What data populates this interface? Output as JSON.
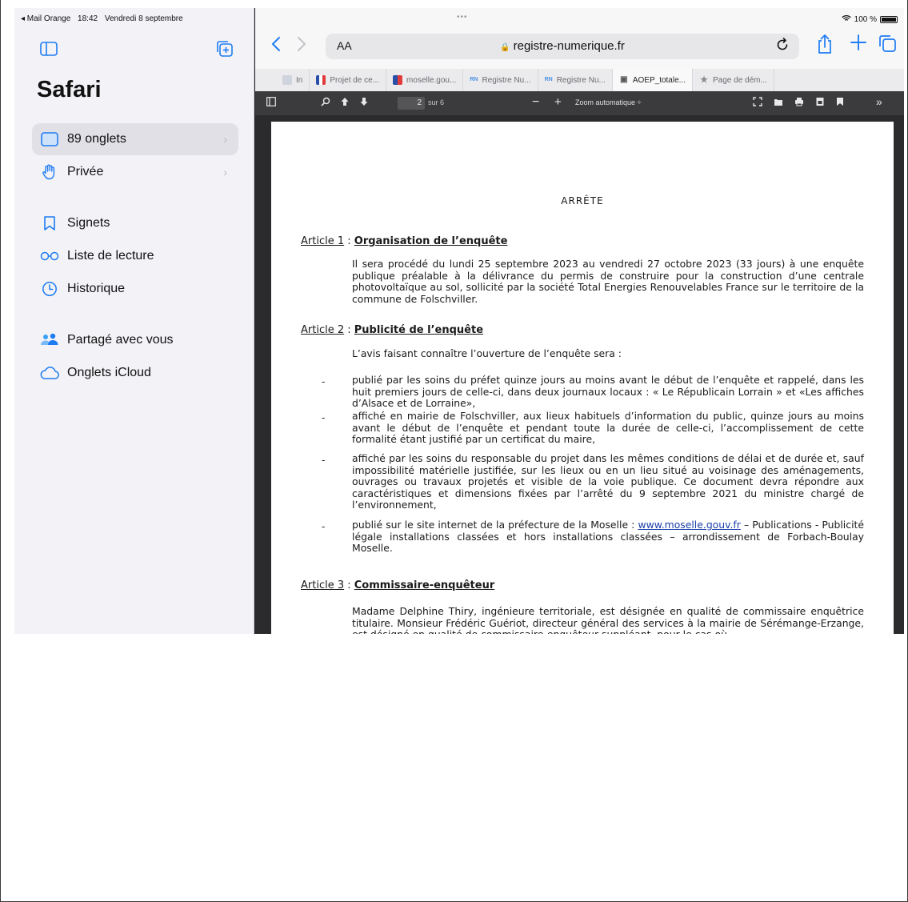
{
  "status": {
    "back_app": "◂ Mail Orange",
    "time": "18:42",
    "date": "Vendredi 8 septembre",
    "battery": "100 %"
  },
  "sidebar": {
    "title": "Safari",
    "items": [
      {
        "label": "89 onglets",
        "icon": "tabs-icon"
      },
      {
        "label": "Privée",
        "icon": "hand-icon"
      },
      {
        "label": "Signets",
        "icon": "bookmark-icon"
      },
      {
        "label": "Liste de lecture",
        "icon": "glasses-icon"
      },
      {
        "label": "Historique",
        "icon": "clock-icon"
      },
      {
        "label": "Partagé avec vous",
        "icon": "people-icon"
      },
      {
        "label": "Onglets iCloud",
        "icon": "cloud-icon"
      }
    ]
  },
  "toolbar": {
    "aa_label": "AA",
    "url": "registre-numerique.fr"
  },
  "tabs": [
    {
      "label": "In",
      "favicon": "",
      "favicon_color": "#cfd3de",
      "active": false
    },
    {
      "label": "Projet de ce...",
      "favicon": "",
      "favicon_color": "#e03a3a",
      "active": false
    },
    {
      "label": "moselle.gou...",
      "favicon": "",
      "favicon_color": "#2a4fa8",
      "active": false
    },
    {
      "label": "Registre Nu...",
      "favicon": "RN",
      "favicon_color": "#4a90e2",
      "active": false
    },
    {
      "label": "Registre Nu...",
      "favicon": "RN",
      "favicon_color": "#4a90e2",
      "active": false
    },
    {
      "label": "AOEP_totale...",
      "favicon": "▣",
      "favicon_color": "#555555",
      "active": true
    },
    {
      "label": "Page de dém...",
      "favicon": "★",
      "favicon_color": "#8a8a8a",
      "active": false
    }
  ],
  "pdf": {
    "page_number": "2",
    "page_count": "sur 6",
    "zoom": "Zoom automatique",
    "heading": "ARRÊTE",
    "articles": [
      {
        "num": "Article 1",
        "sep": " : ",
        "title": "Organisation de l’enquête"
      },
      {
        "num": "Article 2",
        "sep": " : ",
        "title": "Publicité de l’enquête"
      },
      {
        "num": "Article 3",
        "sep": " : ",
        "title": "Commissaire-enquêteur"
      }
    ],
    "a1_para": "Il sera procédé du lundi 25 septembre 2023 au vendredi 27 octobre 2023 (33 jours) à une enquête publique préalable à la délivrance du permis de construire pour la construction d’une centrale photovoltaïque au sol, sollicité par la société Total Energies Renouvelables France sur le territoire de la commune de Folschviller.",
    "a2_intro": "L’avis faisant connaître l’ouverture de l’enquête sera :",
    "bullets": [
      "publié par les soins du préfet quinze jours au moins avant le début de l’enquête et rappelé, dans les huit premiers jours de celle-ci, dans deux journaux locaux : « Le Républicain Lorrain » et «Les affiches d’Alsace et de Lorraine»,",
      "affiché en mairie de Folschviller, aux lieux habituels d’information du public, quinze jours au moins avant le début de l’enquête et pendant toute la durée de celle-ci, l’accomplissement de cette formalité étant justifié par un certificat du maire,",
      "affiché par les soins du responsable du projet dans les mêmes conditions de délai et de durée et, sauf impossibilité matérielle justifiée, sur les lieux ou en un lieu situé au voisinage des aménagements, ouvrages ou travaux projetés et visible de la voie publique. Ce document devra répondre aux caractéristiques et dimensions fixées par l’arrêté du 9 septembre 2021 du ministre chargé de l’environnement,"
    ],
    "bullet4_pre": "publié sur le site internet de la préfecture de la Moselle : ",
    "bullet4_link": "www.moselle.gouv.fr",
    "bullet4_post": " – Publications - Publicité légale installations classées et hors installations classées – arrondissement de Forbach-Boulay Moselle.",
    "bullet_mark": "-",
    "a3_para": "Madame Delphine Thiry, ingénieure territoriale, est désignée en qualité de commissaire enquêtrice titulaire. Monsieur Frédéric Guériot, directeur général des services à la mairie de Sérémange-Erzange, est désigné en qualité de commissaire-enquêteur suppléant, pour le cas où"
  }
}
